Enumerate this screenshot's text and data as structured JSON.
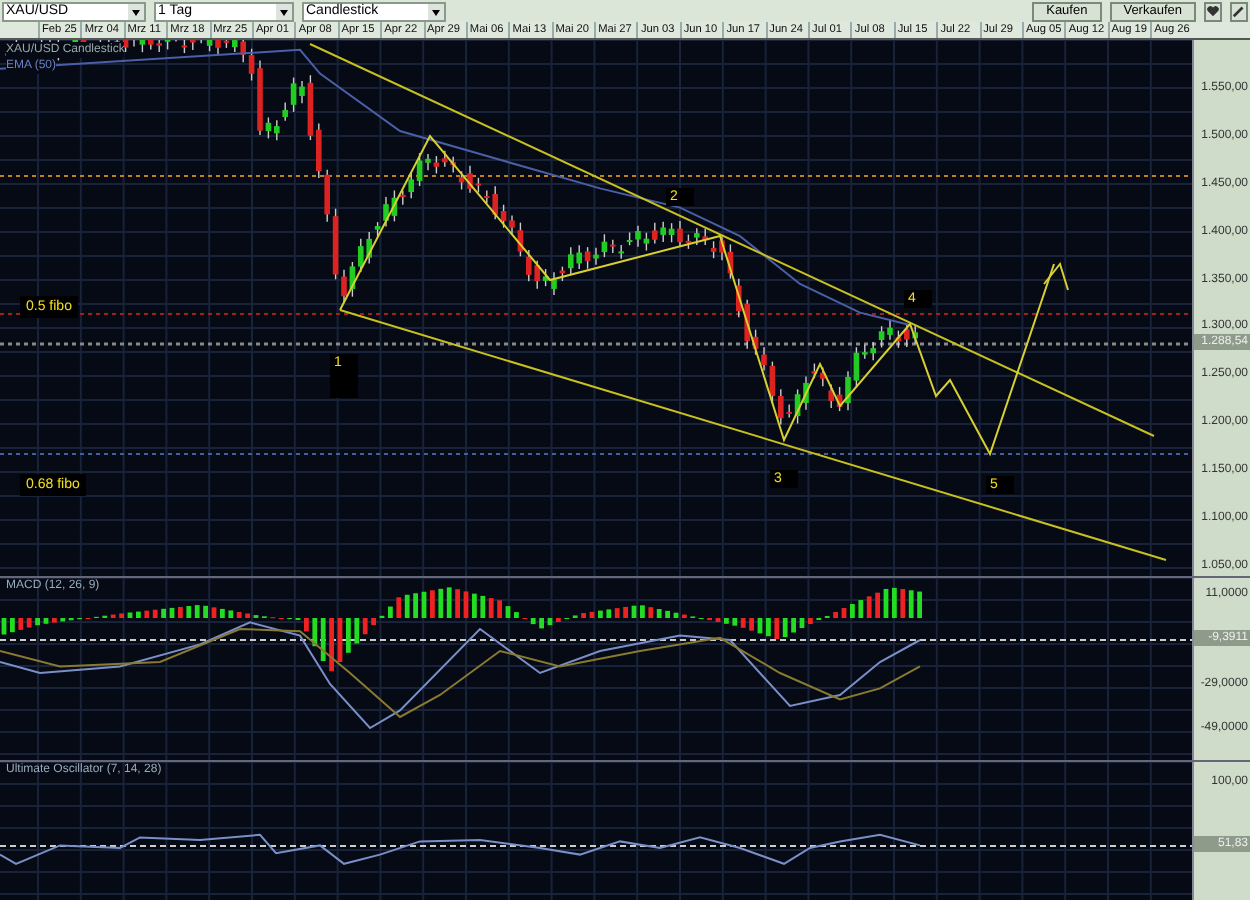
{
  "toolbar": {
    "symbol": "XAU/USD",
    "interval": "1 Tag",
    "chart_type": "Candlestick",
    "buttons": [
      "Kaufen",
      "Verkaufen"
    ]
  },
  "date_axis": [
    "Feb 25",
    "Mrz 04",
    "Mrz 11",
    "Mrz 18",
    "Mrz 25",
    "Apr 01",
    "Apr 08",
    "Apr 15",
    "Apr 22",
    "Apr 29",
    "Mai 06",
    "Mai 13",
    "Mai 20",
    "Mai 27",
    "Jun 03",
    "Jun 10",
    "Jun 17",
    "Jun 24",
    "Jul 01",
    "Jul 08",
    "Jul 15",
    "Jul 22",
    "Jul 29",
    "Aug 05",
    "Aug 12",
    "Aug 19",
    "Aug 26"
  ],
  "price_panel": {
    "legend": [
      "XAU/USD Candlestick",
      "EMA (50)"
    ],
    "fibo_labels": [
      "0.5 fibo",
      "0.68 fibo"
    ],
    "wave_labels": [
      "1",
      "2",
      "3",
      "4",
      "5"
    ],
    "axis": [
      "1.550,00",
      "1.500,00",
      "1.450,00",
      "1.400,00",
      "1.350,00",
      "1.300,00",
      "1.250,00",
      "1.200,00",
      "1.150,00",
      "1.100,00",
      "1.050,00"
    ],
    "current": "1.288,54"
  },
  "macd_panel": {
    "title": "MACD (12, 26, 9)",
    "axis": [
      "11,0000",
      "-29,0000",
      "-49,0000"
    ],
    "current": "-9,3911"
  },
  "uo_panel": {
    "title": "Ultimate Oscillator (7, 14, 28)",
    "axis": [
      "100,00"
    ],
    "current": "51,83"
  }
}
